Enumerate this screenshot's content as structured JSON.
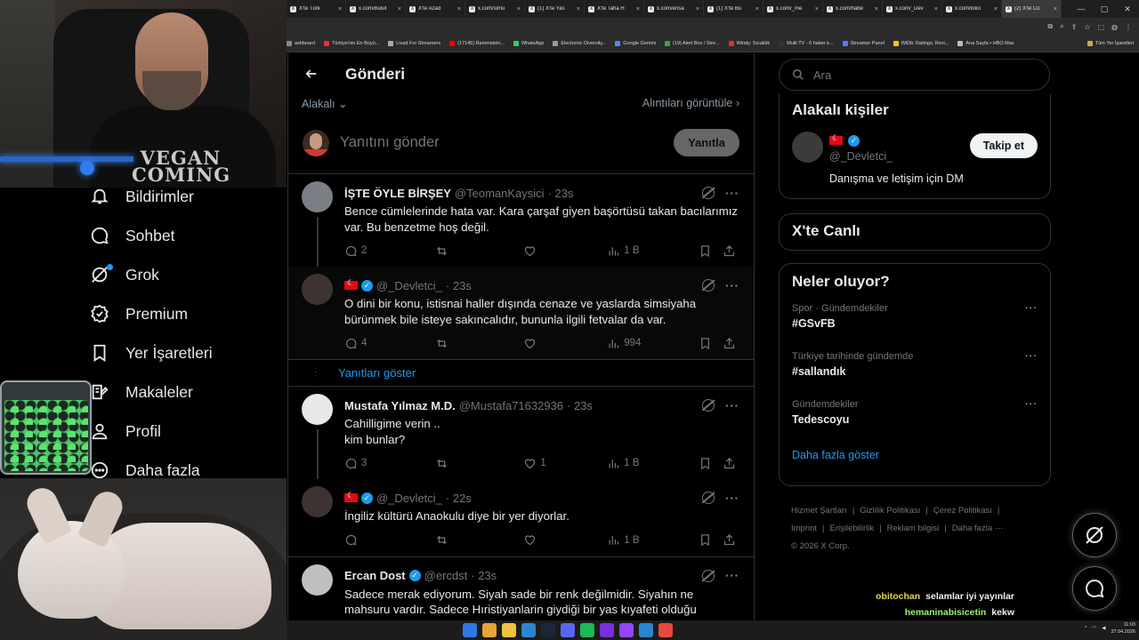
{
  "browser": {
    "tabs": [
      {
        "title": "X'te Türk"
      },
      {
        "title": "x.com/Bulut"
      },
      {
        "title": "X'te Azad"
      },
      {
        "title": "x.com/simü"
      },
      {
        "title": "(1) X'te Yas"
      },
      {
        "title": "X'te Taha H"
      },
      {
        "title": "x.com/ensa"
      },
      {
        "title": "(1) X'te Bu"
      },
      {
        "title": "x.com/_me"
      },
      {
        "title": "x.com/habe"
      },
      {
        "title": "x.com/_Dev"
      },
      {
        "title": "x.com/toko"
      },
      {
        "title": "(2) X'te Co"
      }
    ],
    "bookmarks": [
      {
        "label": "ashboard",
        "color": "#888"
      },
      {
        "label": "Türkiye'nin En Büyü...",
        "color": "#d33"
      },
      {
        "label": "Livad For Streamers",
        "color": "#aaa"
      },
      {
        "label": "(17145) Rammstein...",
        "color": "#f00"
      },
      {
        "label": "WhatsApp",
        "color": "#25d366"
      },
      {
        "label": "Electronic Diversity...",
        "color": "#999"
      },
      {
        "label": "Google Gemini",
        "color": "#4a8af4"
      },
      {
        "label": "(19) Alert Box / Stre...",
        "color": "#3a3"
      },
      {
        "label": "Windy: Sıcaklık",
        "color": "#d33"
      },
      {
        "label": "Multi TV - 6 haber k...",
        "color": "#333"
      },
      {
        "label": "Streamer Panel",
        "color": "#57f"
      },
      {
        "label": "IMDb: Ratings, Revi...",
        "color": "#f5c518"
      },
      {
        "label": "Ana Sayfa • HBO Max",
        "color": "#bbb"
      }
    ],
    "bookmarks_folder": "Tüm Yer İşaretleri"
  },
  "webcam": {
    "shirt_text": "VEGAN COMING"
  },
  "nav": {
    "items": [
      {
        "label": "Bildirimler",
        "icon": "bell-icon"
      },
      {
        "label": "Sohbet",
        "icon": "chat-icon"
      },
      {
        "label": "Grok",
        "icon": "grok-icon"
      },
      {
        "label": "Premium",
        "icon": "premium-icon"
      },
      {
        "label": "Yer İşaretleri",
        "icon": "bookmark-icon"
      },
      {
        "label": "Makaleler",
        "icon": "article-icon"
      },
      {
        "label": "Profil",
        "icon": "profile-icon"
      },
      {
        "label": "Daha fazla",
        "icon": "more-circle-icon"
      }
    ]
  },
  "main": {
    "title": "Gönderi",
    "sort_label": "Alakalı",
    "quotes_link": "Alıntıları görüntüle",
    "composer_placeholder": "Yanıtını gönder",
    "reply_button": "Yanıtla",
    "show_replies": "Yanıtları göster",
    "posts": [
      {
        "name": "İŞTE ÖYLE BİRŞEY",
        "handle": "@TeomanKaysici",
        "time": "· 23s",
        "text": "Bence cümlelerinde hata var. Kara çarşaf giyen başörtüsü takan bacılarımız var. Bu benzetme hoş değil.",
        "replies": "2",
        "reposts": "",
        "likes": "",
        "views": "1 B",
        "verified": false,
        "flag": false
      },
      {
        "name": "",
        "handle": "@_Devletci_",
        "time": "· 23s",
        "text": "O dini bir konu, istisnai haller dışında cenaze ve yaslarda simsiyaha bürünmek bile isteye sakıncalıdır, bununla ilgili fetvalar da var.",
        "replies": "4",
        "reposts": "",
        "likes": "",
        "views": "994",
        "verified": true,
        "flag": true
      },
      {
        "name": "Mustafa Yılmaz M.D.",
        "handle": "@Mustafa71632936",
        "time": "· 23s",
        "text": "Cahilligime verin ..\nkim bunlar?",
        "replies": "3",
        "reposts": "",
        "likes": "1",
        "views": "1 B",
        "verified": false,
        "flag": false
      },
      {
        "name": "",
        "handle": "@_Devletci_",
        "time": "· 22s",
        "text": "İngiliz kültürü Anaokulu diye bir yer diyorlar.",
        "replies": "",
        "reposts": "",
        "likes": "",
        "views": "1 B",
        "verified": true,
        "flag": true
      },
      {
        "name": "Ercan Dost",
        "handle": "@ercdst",
        "time": "· 23s",
        "text": "Sadece merak ediyorum. Siyah sade bir renk değilmidir. Siyahın ne mahsuru vardır. Sadece Hıristiyanlarin giydiği bir yas kıyafeti olduğu çalışması",
        "replies": "",
        "reposts": "",
        "likes": "",
        "views": "",
        "verified": true,
        "flag": false
      }
    ]
  },
  "sidebar": {
    "search_placeholder": "Ara",
    "related_title": "Alakalı kişiler",
    "related_handle": "@_Devletci_",
    "related_bio": "Danışma ve letişim için DM",
    "follow_label": "Takip et",
    "live_title": "X'te Canlı",
    "trends_title": "Neler oluyor?",
    "trends": [
      {
        "meta": "Spor · Gündemdekiler",
        "title": "#GSvFB"
      },
      {
        "meta": "Türkiye tarihinde gündemde",
        "title": "#sallandık"
      },
      {
        "meta": "Gündemdekiler",
        "title": "Tedescoyu"
      }
    ],
    "show_more": "Daha fazla göster",
    "footer": [
      "Hizmet Şartları",
      "|",
      "Gizlilik Politikası",
      "|",
      "Çerez Politikası",
      "|",
      "Imprint",
      "|",
      "Erişilebilirlik",
      "|",
      "Reklam bilgisi",
      "|",
      "Daha fazla ···",
      "© 2026 X Corp."
    ]
  },
  "chat": [
    {
      "user": "obitochan",
      "message": "selamlar iyi yayınlar"
    },
    {
      "user": "hemaninabisicetin",
      "message": "kekw"
    }
  ],
  "taskbar": {
    "time": "11:03",
    "date": "27.04.2026"
  }
}
